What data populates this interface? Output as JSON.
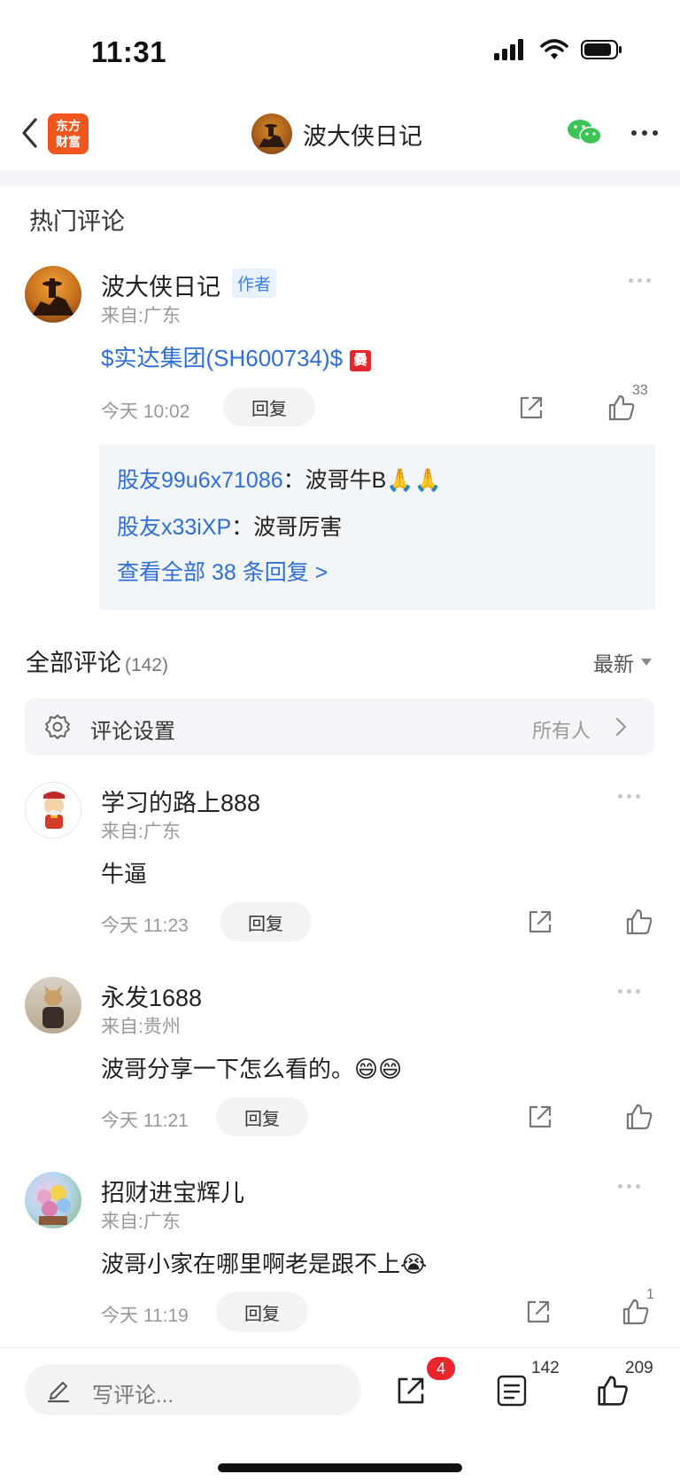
{
  "status": {
    "time": "11:31"
  },
  "nav": {
    "app_logo_line1": "东方",
    "app_logo_line2": "财富",
    "title": "波大侠日记"
  },
  "hot": {
    "title": "热门评论",
    "author_name": "波大侠日记",
    "author_tag": "作者",
    "author_from": "来自:广东",
    "content_link": "$实达集团(SH600734)$",
    "badge_glyph": "爨",
    "time": "今天 10:02",
    "reply_label": "回复",
    "likes": "33",
    "replies": [
      {
        "user": "股友99u6x71086",
        "sep": "：",
        "text": "波哥牛B🙏🙏"
      },
      {
        "user": "股友x33iXP",
        "sep": "：",
        "text": "波哥厉害"
      }
    ],
    "view_all": "查看全部 38 条回复 >"
  },
  "all": {
    "title": "全部评论",
    "count": "(142)",
    "sort_label": "最新",
    "settings_label": "评论设置",
    "settings_value": "所有人"
  },
  "comments": [
    {
      "name": "学习的路上888",
      "from": "来自:广东",
      "content": "牛逼",
      "time": "今天 11:23",
      "reply": "回复",
      "likes": ""
    },
    {
      "name": "永发1688",
      "from": "来自:贵州",
      "content": "波哥分享一下怎么看的。😄😄",
      "time": "今天 11:21",
      "reply": "回复",
      "likes": ""
    },
    {
      "name": "招财进宝辉儿",
      "from": "来自:广东",
      "content": "波哥小家在哪里啊老是跟不上😭",
      "time": "今天 11:19",
      "reply": "回复",
      "likes": "1"
    }
  ],
  "bottom": {
    "write_placeholder": "写评论...",
    "share_badge": "4",
    "comments_count": "142",
    "likes_count": "209"
  },
  "colors": {
    "accent_blue": "#2f6fd6",
    "brand_orange": "#f0551e",
    "badge_red": "#e8262c"
  }
}
